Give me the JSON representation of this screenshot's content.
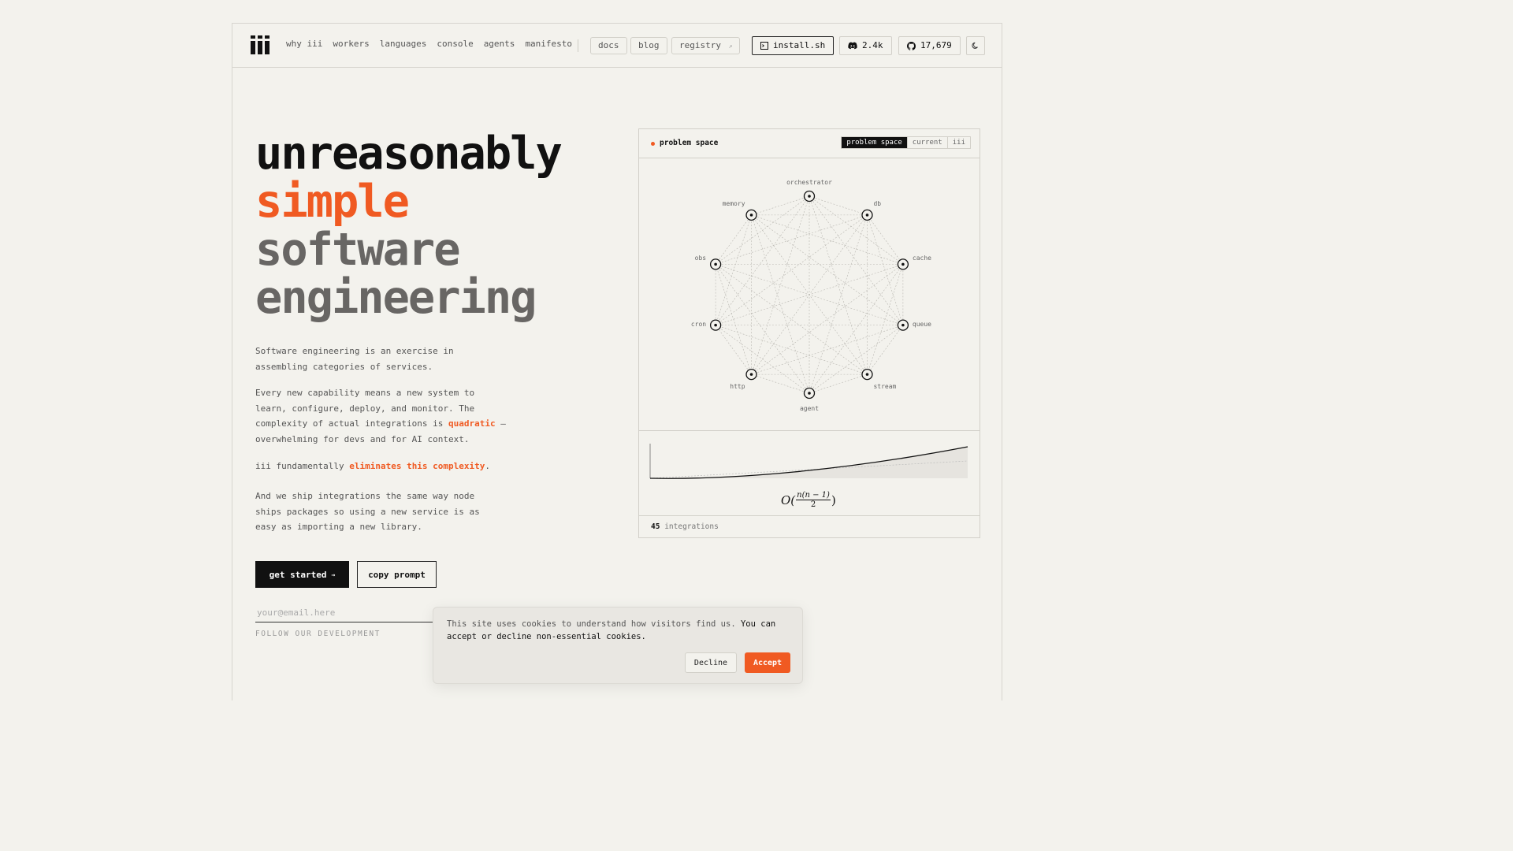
{
  "nav": {
    "links": [
      "why iii",
      "workers",
      "languages",
      "console",
      "agents",
      "manifesto"
    ],
    "pills": [
      "docs",
      "blog",
      "registry"
    ],
    "registry_arrow": "↗",
    "install_label": "install.sh",
    "discord_count": "2.4k",
    "github_count": "17,679",
    "theme_icon": "moon-icon"
  },
  "hero": {
    "line1": "unreasonably",
    "line2": "simple",
    "line3": "software",
    "line4": "engineering"
  },
  "body": {
    "p1": "Software engineering is an exercise in assembling categories of services.",
    "p2_start": "Every new capability means a new system to learn, configure, deploy, and monitor. The complexity of actual integrations is ",
    "p2_accent": "quadratic",
    "p2_end": " — overwhelming for devs and for AI context.",
    "p3_start": "iii fundamentally ",
    "p3_accent": "eliminates this complexity",
    "p3_end": ".",
    "p4": "And we ship integrations the same way node ships packages so using a new service is as easy as importing a new library."
  },
  "cta": {
    "primary": "get started",
    "primary_arrow": "→",
    "secondary": "copy prompt"
  },
  "subscribe": {
    "placeholder": "your@email.here",
    "caption": "FOLLOW OUR DEVELOPMENT"
  },
  "panel": {
    "title": "problem space",
    "tabs": [
      "problem space",
      "current",
      "iii"
    ],
    "active_tab": "problem space",
    "nodes": [
      "orchestrator",
      "db",
      "cache",
      "queue",
      "stream",
      "agent",
      "http",
      "cron",
      "obs",
      "memory"
    ],
    "formula": {
      "prefix": "O(",
      "numerator": "n(n − 1)",
      "denominator": "2",
      "suffix": ")"
    },
    "footer_count": "45",
    "footer_label": "integrations"
  },
  "cookie": {
    "text_start": "This site uses cookies to understand how visitors find us. ",
    "text_strong": "You can accept or decline non-essential cookies.",
    "decline": "Decline",
    "accept": "Accept"
  },
  "colors": {
    "accent": "#f05a22",
    "background": "#f3f2ed",
    "ink": "#111111"
  }
}
